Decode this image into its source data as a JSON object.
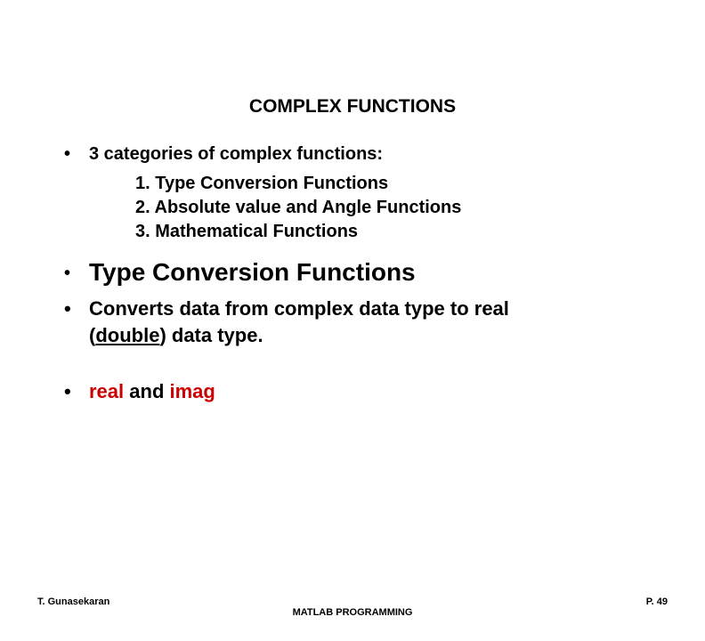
{
  "slide": {
    "title": "COMPLEX FUNCTIONS",
    "bullet1_intro": "3 categories of complex functions:",
    "sub1": "1. Type Conversion Functions",
    "sub2": "2. Absolute value and Angle Functions",
    "sub3": "3. Mathematical Functions",
    "subheading": "Type Conversion Functions",
    "converts_line1": "Converts data from complex data type to real",
    "converts_line2_a": "(",
    "converts_line2_b": "double",
    "converts_line2_c": ") data type.",
    "realimag_real": "real",
    "realimag_and": " and ",
    "realimag_imag": "imag"
  },
  "footer": {
    "author": "T. Gunasekaran",
    "center": "MATLAB PROGRAMMING",
    "page": "P. 49"
  }
}
